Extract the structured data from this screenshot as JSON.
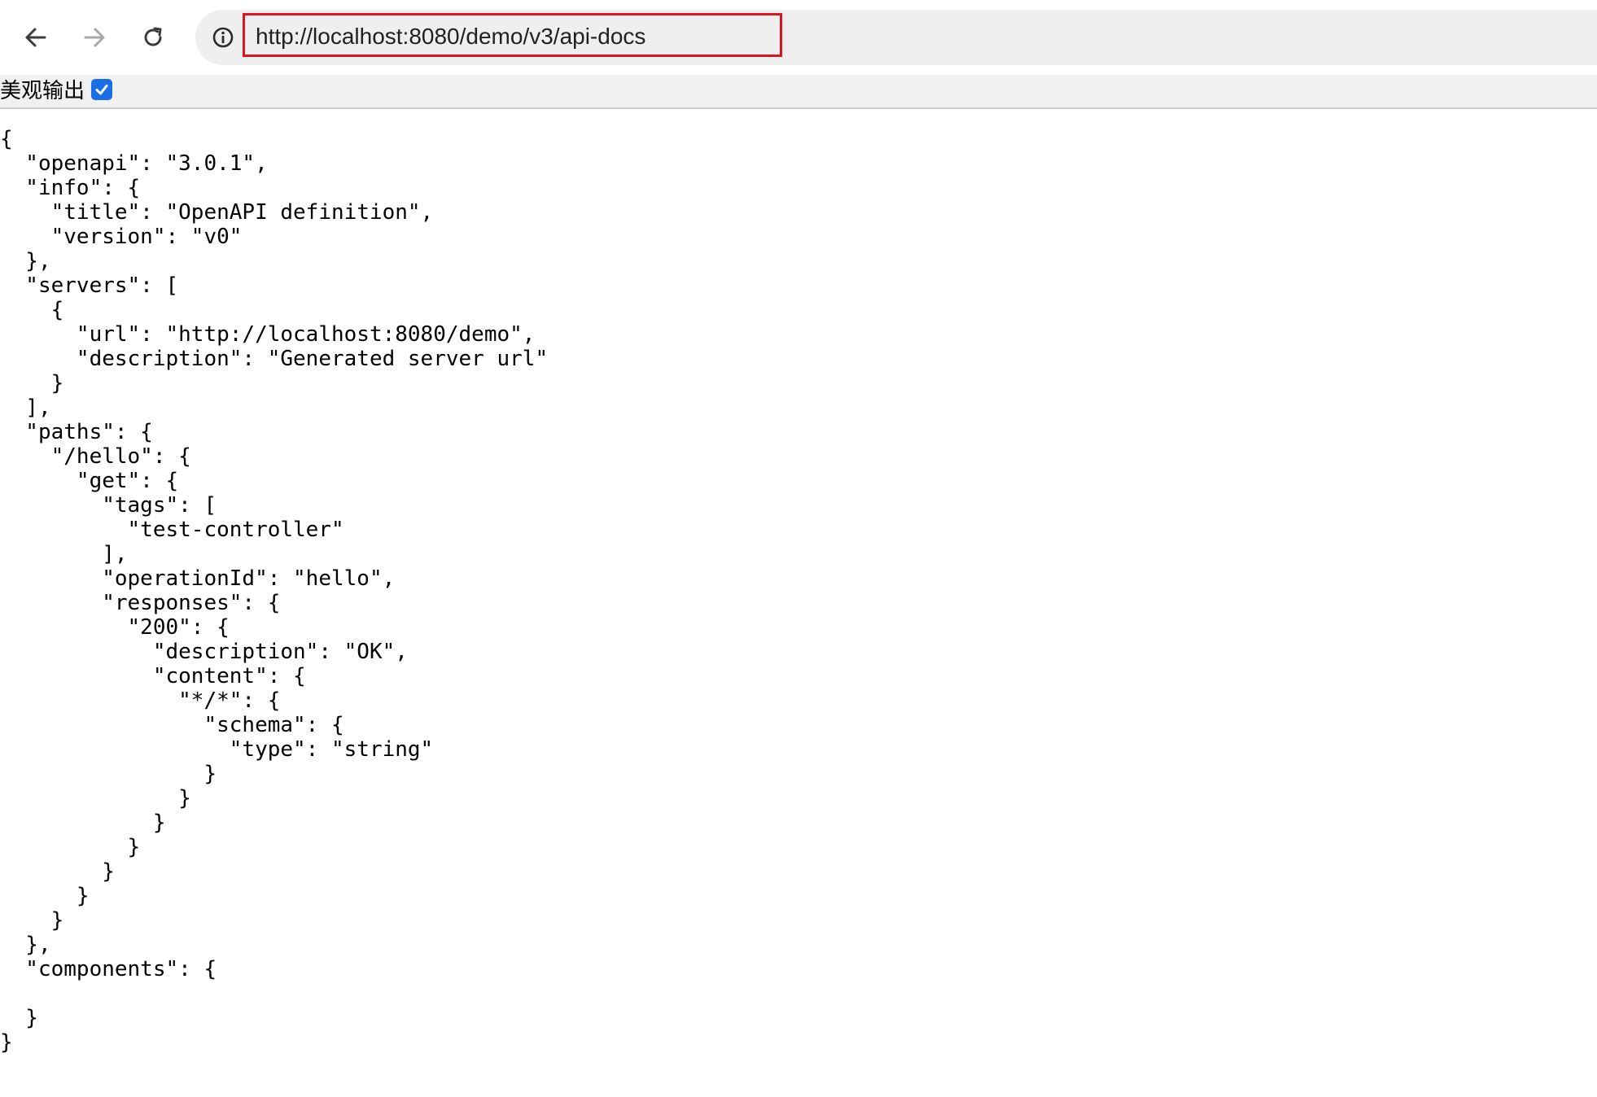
{
  "browser": {
    "url": "http://localhost:8080/demo/v3/api-docs",
    "icons": {
      "back": "arrow-left-icon",
      "forward": "arrow-right-icon",
      "reload": "reload-icon",
      "info": "info-icon"
    },
    "highlight_color": "#e0141e"
  },
  "viewer": {
    "pretty_print_label": "美观输出",
    "pretty_print_checked": true,
    "checkbox_color": "#1a6ee8",
    "json_text": "{\n  \"openapi\": \"3.0.1\",\n  \"info\": {\n    \"title\": \"OpenAPI definition\",\n    \"version\": \"v0\"\n  },\n  \"servers\": [\n    {\n      \"url\": \"http://localhost:8080/demo\",\n      \"description\": \"Generated server url\"\n    }\n  ],\n  \"paths\": {\n    \"/hello\": {\n      \"get\": {\n        \"tags\": [\n          \"test-controller\"\n        ],\n        \"operationId\": \"hello\",\n        \"responses\": {\n          \"200\": {\n            \"description\": \"OK\",\n            \"content\": {\n              \"*/*\": {\n                \"schema\": {\n                  \"type\": \"string\"\n                }\n              }\n            }\n          }\n        }\n      }\n    }\n  },\n  \"components\": {\n\n  }\n}"
  }
}
